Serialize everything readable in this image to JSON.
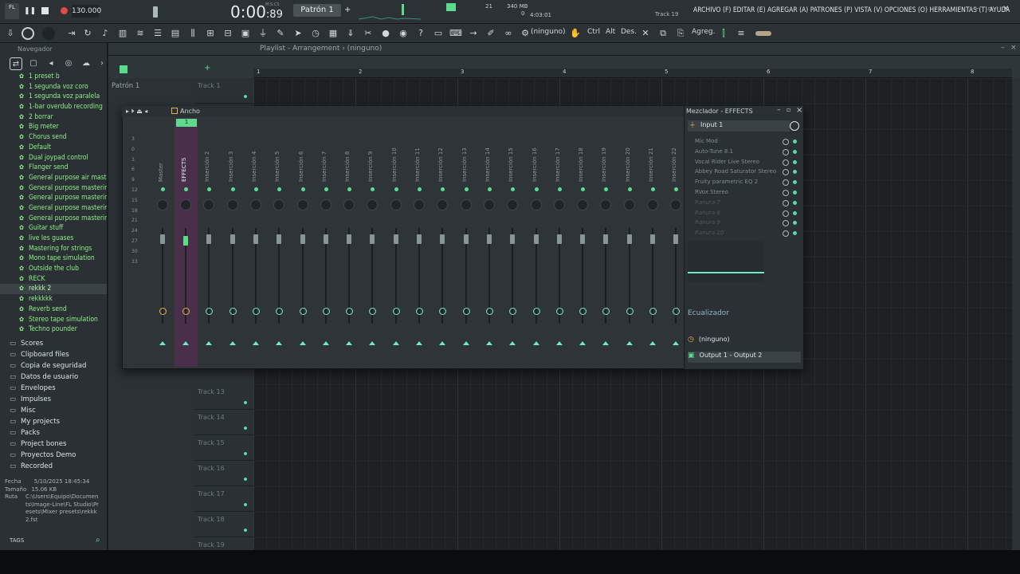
{
  "topbar": {
    "logo_label": "FL",
    "tempo": "130.000",
    "time_display": "0:00",
    "time_ms": ":89",
    "time_mode": "M:S:CS",
    "pattern": "Patrón 1",
    "cpu_value": "21",
    "mem": "340 MB",
    "poly": "0",
    "time_clock": "4:03:01",
    "hint_track": "Track 19",
    "menu": [
      "ARCHIVO (F)",
      "EDITAR (E)",
      "AGREGAR (A)",
      "PATRONES (P)",
      "VISTA (V)",
      "OPCIONES (O)",
      "HERRAMIENTAS (T)",
      "AYUDA"
    ]
  },
  "toolbar": {
    "snap": "(ninguno)",
    "ctrl": "Ctrl",
    "alt": "Alt",
    "des": "Des.",
    "agreg": "Agreg."
  },
  "browser": {
    "title": "Navegador",
    "presets": [
      "1 preset b",
      "1 segunda voz coro",
      "1 segunda voz paralela",
      "1-bar overdub recording",
      "2 borrar",
      "Big meter",
      "Chorus send",
      "Default",
      "Dual joypad control",
      "Flanger send",
      "General purpose air mastering",
      "General purpose mastering 2",
      "General purpose mastering 3",
      "General purpose mastering 4",
      "General purpose mastering",
      "Guitar stuff",
      "live les guases",
      "Mastering for strings",
      "Mono tape simulation",
      "Outside the club",
      "RECK",
      "rekkk 2",
      "rekkkkk",
      "Reverb send",
      "Stereo tape simulation",
      "Techno pounder"
    ],
    "selected_preset": "rekkk 2",
    "folders": [
      "Scores",
      "Clipboard files",
      "Copia de seguridad",
      "Datos de usuario",
      "Envelopes",
      "Impulses",
      "Misc",
      "My projects",
      "Packs",
      "Project bones",
      "Proyectos Demo",
      "Recorded"
    ],
    "info": {
      "fecha_label": "Fecha",
      "fecha": "5/10/2025 18:45:34",
      "tamano_label": "Tamaño",
      "tamano": "15.06 KB",
      "ruta_label": "Ruta",
      "ruta": "C:\\Users\\Equipo\\Documents\\Image-Line\\FL Studio\\Presets\\Mixer presets\\rekkk 2.fst"
    },
    "tags": "TAGS"
  },
  "playlist": {
    "title": "Playlist - Arrangement › (ninguno)",
    "pattern_label": "Patrón 1",
    "ruler": [
      "1",
      "2",
      "3",
      "4",
      "5",
      "6",
      "7",
      "8"
    ],
    "tracks_top": [
      "Track 1"
    ],
    "tracks_bottom": [
      "Track 13",
      "Track 14",
      "Track 15",
      "Track 16",
      "Track 17",
      "Track 18",
      "Track 19"
    ]
  },
  "mixer": {
    "header_mode": "Ancho",
    "scale": [
      "3",
      "0",
      "3",
      "6",
      "9",
      "12",
      "15",
      "18",
      "21",
      "24",
      "27",
      "30",
      "33"
    ],
    "strips": [
      "Master",
      "EFFECTS",
      "Inserción 2",
      "Inserción 3",
      "Inserción 4",
      "Inserción 5",
      "Inserción 6",
      "Inserción 7",
      "Inserción 8",
      "Inserción 9",
      "Inserción 10",
      "Inserción 11",
      "Inserción 12",
      "Inserción 13",
      "Inserción 14",
      "Inserción 15",
      "Inserción 16",
      "Inserción 17",
      "Inserción 18",
      "Inserción 19",
      "Inserción 20",
      "Inserción 21",
      "Inserción 22"
    ],
    "selected_strip_number": "1",
    "panel_title": "Mezclador - EFFECTS",
    "input": "Input 1",
    "slots": [
      "Mic Mod",
      "Auto-Tune 8.1",
      "Vocal Rider Live Stereo",
      "Abbey Road Saturator Stereo",
      "Fruity parametric EQ 2",
      "RVox Stereo",
      "Ranura 7",
      "Ranura 8",
      "Ranura 9",
      "Ranura 10"
    ],
    "eq_label": "Ecualizador",
    "output_none": "(ninguno)",
    "output": "Output 1 - Output 2"
  },
  "colors": {
    "accent_green": "#5bdc8d",
    "selected_strip": "#4a2f4b",
    "background": "#1d2124"
  }
}
